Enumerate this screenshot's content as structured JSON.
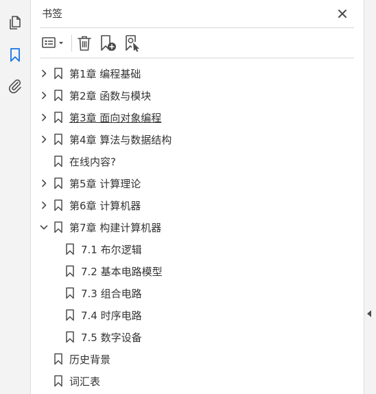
{
  "panel": {
    "title": "书签"
  },
  "rail": {
    "items": [
      "pages-icon",
      "bookmark-icon",
      "attachment-icon"
    ]
  },
  "toolbar": {
    "icons": [
      "options-menu-icon",
      "delete-icon",
      "new-bookmark-icon",
      "bookmark-from-selection-icon"
    ]
  },
  "bookmarks": [
    {
      "label": "第1章 编程基础",
      "level": 0,
      "expander": "collapsed"
    },
    {
      "label": "第2章 函数与模块",
      "level": 0,
      "expander": "collapsed"
    },
    {
      "label": "第3章 面向对象编程",
      "level": 0,
      "expander": "collapsed",
      "hovered": true
    },
    {
      "label": "第4章 算法与数据结构",
      "level": 0,
      "expander": "collapsed"
    },
    {
      "label": "在线内容?",
      "level": 0,
      "expander": "none"
    },
    {
      "label": "第5章 计算理论",
      "level": 0,
      "expander": "collapsed"
    },
    {
      "label": "第6章 计算机器",
      "level": 0,
      "expander": "collapsed"
    },
    {
      "label": "第7章 构建计算机器",
      "level": 0,
      "expander": "expanded"
    },
    {
      "label": "7.1 布尔逻辑",
      "level": 1,
      "expander": "none"
    },
    {
      "label": "7.2 基本电路模型",
      "level": 1,
      "expander": "none"
    },
    {
      "label": "7.3 组合电路",
      "level": 1,
      "expander": "none"
    },
    {
      "label": "7.4 时序电路",
      "level": 1,
      "expander": "none"
    },
    {
      "label": "7.5 数字设备",
      "level": 1,
      "expander": "none"
    },
    {
      "label": "历史背景",
      "level": 0,
      "expander": "none"
    },
    {
      "label": "词汇表",
      "level": 0,
      "expander": "none"
    }
  ],
  "colors": {
    "accent": "#1473e6",
    "icon": "#4b4b4b",
    "text": "#333333"
  }
}
